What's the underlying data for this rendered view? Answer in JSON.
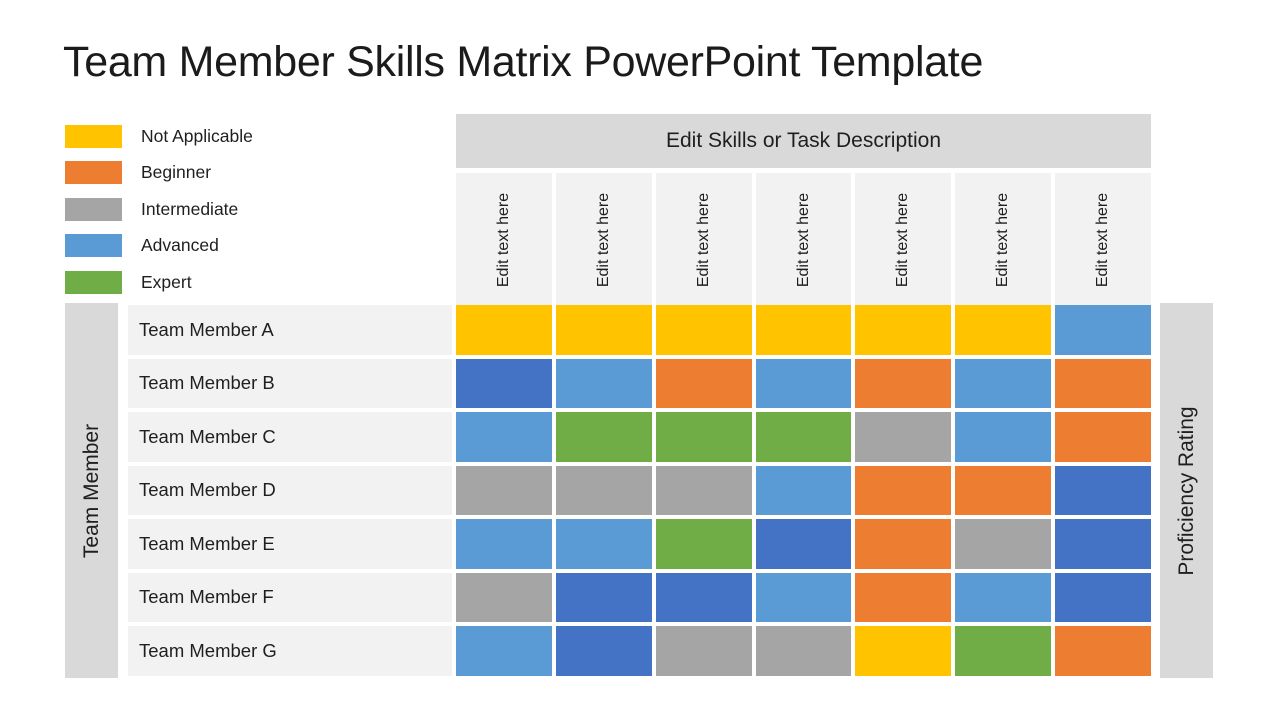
{
  "title": "Team Member Skills Matrix PowerPoint Template",
  "legend": {
    "items": [
      {
        "label": "Not Applicable",
        "color": "#FFC300"
      },
      {
        "label": "Beginner",
        "color": "#ED7D31"
      },
      {
        "label": "Intermediate",
        "color": "#A5A5A5"
      },
      {
        "label": "Advanced",
        "color": "#5B9BD5"
      },
      {
        "label": "Expert",
        "color": "#70AD47"
      }
    ]
  },
  "matrix": {
    "banner_title": "Edit Skills or Task Description",
    "left_axis_label": "Team Member",
    "right_axis_label": "Proficiency Rating",
    "column_headers": [
      "Edit text here",
      "Edit text here",
      "Edit text here",
      "Edit text here",
      "Edit text here",
      "Edit text here",
      "Edit text here"
    ],
    "rows": [
      {
        "label": "Team Member  A",
        "cells": [
          "#FFC300",
          "#FFC300",
          "#FFC300",
          "#FFC300",
          "#FFC300",
          "#FFC300",
          "#5B9BD5"
        ]
      },
      {
        "label": "Team Member  B",
        "cells": [
          "#4472C4",
          "#5B9BD5",
          "#ED7D31",
          "#5B9BD5",
          "#ED7D31",
          "#5B9BD5",
          "#ED7D31"
        ]
      },
      {
        "label": "Team Member  C",
        "cells": [
          "#5B9BD5",
          "#70AD47",
          "#70AD47",
          "#70AD47",
          "#A5A5A5",
          "#5B9BD5",
          "#ED7D31"
        ]
      },
      {
        "label": "Team Member  D",
        "cells": [
          "#A5A5A5",
          "#A5A5A5",
          "#A5A5A5",
          "#5B9BD5",
          "#ED7D31",
          "#ED7D31",
          "#4472C4"
        ]
      },
      {
        "label": "Team Member  E",
        "cells": [
          "#5B9BD5",
          "#5B9BD5",
          "#70AD47",
          "#4472C4",
          "#ED7D31",
          "#A5A5A5",
          "#4472C4"
        ]
      },
      {
        "label": "Team Member  F",
        "cells": [
          "#A5A5A5",
          "#4472C4",
          "#4472C4",
          "#5B9BD5",
          "#ED7D31",
          "#5B9BD5",
          "#4472C4"
        ]
      },
      {
        "label": "Team Member  G",
        "cells": [
          "#5B9BD5",
          "#4472C4",
          "#A5A5A5",
          "#A5A5A5",
          "#FFC300",
          "#70AD47",
          "#ED7D31"
        ]
      }
    ]
  },
  "chart_data": {
    "type": "heatmap",
    "title": "Team Member Skills Matrix PowerPoint Template",
    "xlabel": "Edit Skills or Task Description",
    "ylabel": "Team Member",
    "legend_title": "Proficiency Rating",
    "grid": false,
    "legend_position": "left",
    "categories_x": [
      "Edit text here",
      "Edit text here",
      "Edit text here",
      "Edit text here",
      "Edit text here",
      "Edit text here",
      "Edit text here"
    ],
    "categories_y": [
      "Team Member  A",
      "Team Member  B",
      "Team Member  C",
      "Team Member  D",
      "Team Member  E",
      "Team Member  F",
      "Team Member  G"
    ],
    "scale": [
      {
        "label": "Not Applicable",
        "color": "#FFC300"
      },
      {
        "label": "Beginner",
        "color": "#ED7D31"
      },
      {
        "label": "Intermediate",
        "color": "#A5A5A5"
      },
      {
        "label": "Advanced",
        "color": "#5B9BD5"
      },
      {
        "label": "Expert",
        "color": "#70AD47"
      }
    ],
    "values": [
      [
        "Not Applicable",
        "Not Applicable",
        "Not Applicable",
        "Not Applicable",
        "Not Applicable",
        "Not Applicable",
        "Advanced"
      ],
      [
        "Advanced",
        "Advanced",
        "Beginner",
        "Advanced",
        "Beginner",
        "Advanced",
        "Beginner"
      ],
      [
        "Advanced",
        "Expert",
        "Expert",
        "Expert",
        "Intermediate",
        "Advanced",
        "Beginner"
      ],
      [
        "Intermediate",
        "Intermediate",
        "Intermediate",
        "Advanced",
        "Beginner",
        "Beginner",
        "Advanced"
      ],
      [
        "Advanced",
        "Advanced",
        "Expert",
        "Advanced",
        "Beginner",
        "Intermediate",
        "Advanced"
      ],
      [
        "Intermediate",
        "Advanced",
        "Advanced",
        "Advanced",
        "Beginner",
        "Advanced",
        "Advanced"
      ],
      [
        "Advanced",
        "Advanced",
        "Intermediate",
        "Intermediate",
        "Not Applicable",
        "Expert",
        "Beginner"
      ]
    ]
  }
}
